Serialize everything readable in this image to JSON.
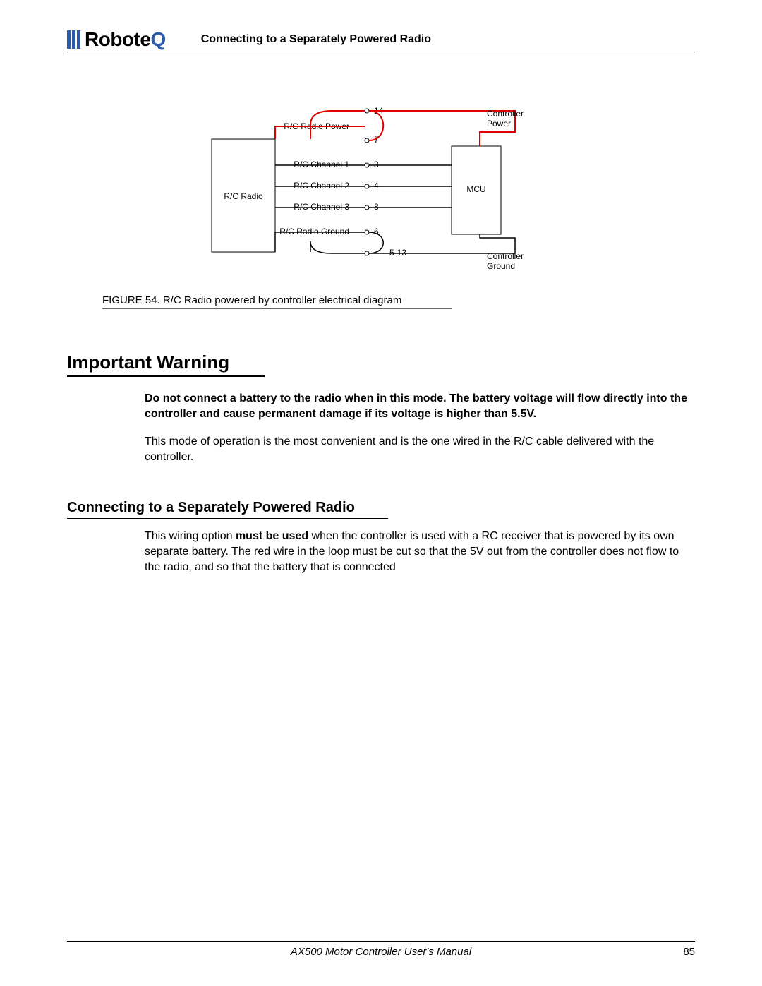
{
  "logo": {
    "main": "Robote",
    "accent": "Q"
  },
  "header": {
    "title": "Connecting to a Separately Powered Radio"
  },
  "diagram": {
    "left_block": "R/C Radio",
    "right_block": "MCU",
    "labels": {
      "rc_power": "R/C Radio Power",
      "ch1": "R/C Channel 1",
      "ch2": "R/C Channel 2",
      "ch3": "R/C Channel 3",
      "rc_ground": "R/C Radio Ground",
      "ctrl_power": "Controller Power",
      "ctrl_ground": "Controller Ground"
    },
    "pins": {
      "p14": "14",
      "p7": "7",
      "p3": "3",
      "p4": "4",
      "p8": "8",
      "p6": "6",
      "p5_13": "5-13"
    }
  },
  "figure": {
    "caption": "FIGURE 54.  R/C Radio powered by controller electrical diagram"
  },
  "warning": {
    "heading": "Important Warning",
    "bold_text": "Do not connect a battery to the radio when in this mode. The battery voltage will flow directly into the controller and cause permanent damage if its voltage is higher than 5.5V.",
    "body": "This mode of operation is the most convenient and is the one wired in the R/C cable delivered with the controller."
  },
  "section2": {
    "heading": "Connecting to a Separately Powered Radio",
    "body_pre": "This wiring option ",
    "body_bold": "must be used",
    "body_post": " when the controller is used with a RC receiver that is powered by its own separate battery. The red wire in the loop must be cut so that the 5V out from the controller does not flow to the radio, and so that the battery that is connected"
  },
  "footer": {
    "title": "AX500 Motor Controller User's Manual",
    "page": "85"
  }
}
